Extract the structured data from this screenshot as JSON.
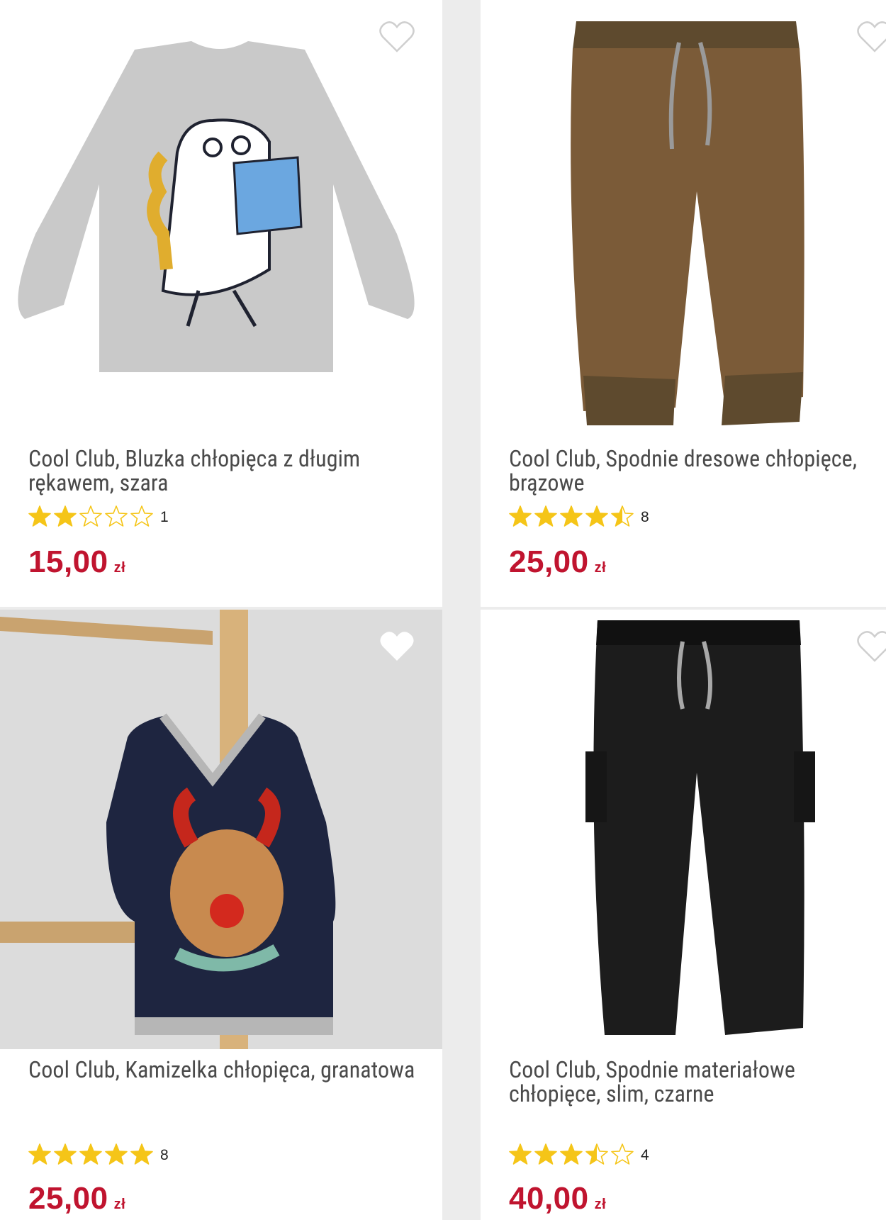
{
  "products": [
    {
      "title": "Cool Club, Bluzka chłopięca z długim rękawem, szara",
      "rating": 2,
      "rating_count": "1",
      "price": "15,00",
      "currency": "zł",
      "favorite_icon": "heart-outline-icon"
    },
    {
      "title": "Cool Club, Spodnie dresowe chłopięce, brązowe",
      "rating": 4.5,
      "rating_count": "8",
      "price": "25,00",
      "currency": "zł",
      "favorite_icon": "heart-outline-icon"
    },
    {
      "title": "Cool Club, Kamizelka chłopięca, granatowa",
      "rating": 5,
      "rating_count": "8",
      "price": "25,00",
      "currency": "zł",
      "favorite_icon": "heart-filled-icon"
    },
    {
      "title": "Cool Club, Spodnie materiałowe chłopięce, slim, czarne",
      "rating": 3.5,
      "rating_count": "4",
      "price": "40,00",
      "currency": "zł",
      "favorite_icon": "heart-outline-icon"
    }
  ],
  "colors": {
    "price": "#c0142f",
    "star": "#f5c518",
    "title": "#4a4a4a",
    "background": "#ececec"
  }
}
